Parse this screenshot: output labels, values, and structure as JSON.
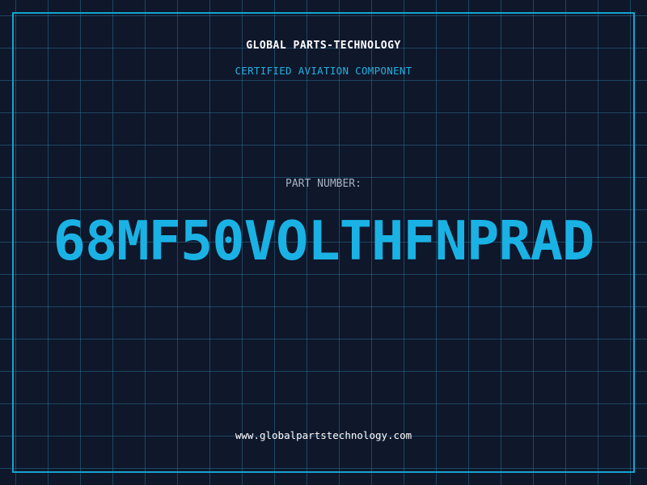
{
  "header": {
    "company": "GLOBAL PARTS-TECHNOLOGY",
    "tagline": "CERTIFIED AVIATION COMPONENT"
  },
  "part": {
    "label": "PART NUMBER:",
    "number": "68MF50VOLTHFNPRAD"
  },
  "footer": {
    "url": "www.globalpartstechnology.com"
  },
  "colors": {
    "background": "#0f172b",
    "accent": "#14a3cf",
    "grid": "#286e8c",
    "text": "#ffffff",
    "muted": "#a7b3c4"
  }
}
